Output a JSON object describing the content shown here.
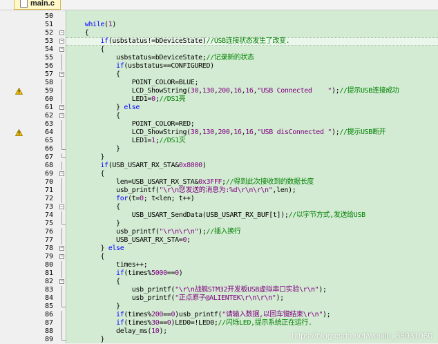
{
  "tab": {
    "file_name": "main.c",
    "icon": "file-icon"
  },
  "watermark": "https://blog.csdn.net/weixin_38931060",
  "colors": {
    "keyword": "#0000ff",
    "number": "#800080",
    "string": "#800080",
    "comment": "#008000",
    "editor_bg": "#d3ebd3"
  },
  "highlight_line": 53,
  "lines": [
    {
      "n": "50",
      "fold": "",
      "warn": false,
      "tokens": []
    },
    {
      "n": "51",
      "fold": "",
      "warn": false,
      "tokens": [
        [
          "p",
          "    "
        ],
        [
          "k",
          "while"
        ],
        [
          "p",
          "("
        ],
        [
          "n",
          "1"
        ],
        [
          "p",
          ")"
        ]
      ]
    },
    {
      "n": "52",
      "fold": "box",
      "warn": false,
      "tokens": [
        [
          "p",
          "    {"
        ]
      ]
    },
    {
      "n": "53",
      "fold": "box",
      "warn": false,
      "tokens": [
        [
          "p",
          "        "
        ],
        [
          "k",
          "if"
        ],
        [
          "p",
          "(usbstatus!=bDeviceState)"
        ],
        [
          "c",
          "//USB连接状态发生了改变."
        ]
      ]
    },
    {
      "n": "54",
      "fold": "box",
      "warn": false,
      "tokens": [
        [
          "p",
          "        {"
        ]
      ]
    },
    {
      "n": "55",
      "fold": "line",
      "warn": false,
      "tokens": [
        [
          "p",
          "            usbstatus=bDeviceState;"
        ],
        [
          "c",
          "//记录新的状态"
        ]
      ]
    },
    {
      "n": "56",
      "fold": "line",
      "warn": false,
      "tokens": [
        [
          "p",
          "            "
        ],
        [
          "k",
          "if"
        ],
        [
          "p",
          "(usbstatus==CONFIGURED)"
        ]
      ]
    },
    {
      "n": "57",
      "fold": "box",
      "warn": false,
      "tokens": [
        [
          "p",
          "            {"
        ]
      ]
    },
    {
      "n": "58",
      "fold": "line",
      "warn": false,
      "tokens": [
        [
          "p",
          "                POINT_COLOR=BLUE;"
        ]
      ]
    },
    {
      "n": "59",
      "fold": "line",
      "warn": true,
      "tokens": [
        [
          "p",
          "                LCD_ShowString("
        ],
        [
          "n",
          "30"
        ],
        [
          "p",
          ","
        ],
        [
          "n",
          "130"
        ],
        [
          "p",
          ","
        ],
        [
          "n",
          "200"
        ],
        [
          "p",
          ","
        ],
        [
          "n",
          "16"
        ],
        [
          "p",
          ","
        ],
        [
          "n",
          "16"
        ],
        [
          "p",
          ","
        ],
        [
          "s",
          "\"USB Connected    \""
        ],
        [
          "p",
          ");"
        ],
        [
          "c",
          "//提示USB连接成功"
        ]
      ]
    },
    {
      "n": "60",
      "fold": "line",
      "warn": false,
      "tokens": [
        [
          "p",
          "                LED1="
        ],
        [
          "n",
          "0"
        ],
        [
          "p",
          ";"
        ],
        [
          "c",
          "//DS1亮"
        ]
      ]
    },
    {
      "n": "61",
      "fold": "box",
      "warn": false,
      "tokens": [
        [
          "p",
          "            } "
        ],
        [
          "k",
          "else"
        ]
      ]
    },
    {
      "n": "62",
      "fold": "box",
      "warn": false,
      "tokens": [
        [
          "p",
          "            {"
        ]
      ]
    },
    {
      "n": "63",
      "fold": "line",
      "warn": false,
      "tokens": [
        [
          "p",
          "                POINT_COLOR=RED;"
        ]
      ]
    },
    {
      "n": "64",
      "fold": "line",
      "warn": true,
      "tokens": [
        [
          "p",
          "                LCD_ShowString("
        ],
        [
          "n",
          "30"
        ],
        [
          "p",
          ","
        ],
        [
          "n",
          "130"
        ],
        [
          "p",
          ","
        ],
        [
          "n",
          "200"
        ],
        [
          "p",
          ","
        ],
        [
          "n",
          "16"
        ],
        [
          "p",
          ","
        ],
        [
          "n",
          "16"
        ],
        [
          "p",
          ","
        ],
        [
          "s",
          "\"USB disConnected \""
        ],
        [
          "p",
          ");"
        ],
        [
          "c",
          "//提示USB断开"
        ]
      ]
    },
    {
      "n": "65",
      "fold": "line",
      "warn": false,
      "tokens": [
        [
          "p",
          "                LED1="
        ],
        [
          "n",
          "1"
        ],
        [
          "p",
          ";"
        ],
        [
          "c",
          "//DS1灭"
        ]
      ]
    },
    {
      "n": "66",
      "fold": "end",
      "warn": false,
      "tokens": [
        [
          "p",
          "            }"
        ]
      ]
    },
    {
      "n": "67",
      "fold": "end",
      "warn": false,
      "tokens": [
        [
          "p",
          "        }"
        ]
      ]
    },
    {
      "n": "68",
      "fold": "line",
      "warn": false,
      "tokens": [
        [
          "p",
          "        "
        ],
        [
          "k",
          "if"
        ],
        [
          "p",
          "(USB_USART_RX_STA&"
        ],
        [
          "n",
          "0x8000"
        ],
        [
          "p",
          ")"
        ]
      ]
    },
    {
      "n": "69",
      "fold": "box",
      "warn": false,
      "tokens": [
        [
          "p",
          "        {"
        ]
      ]
    },
    {
      "n": "70",
      "fold": "line",
      "warn": false,
      "tokens": [
        [
          "p",
          "            len=USB_USART_RX_STA&"
        ],
        [
          "n",
          "0x3FFF"
        ],
        [
          "p",
          ";"
        ],
        [
          "c",
          "//得到此次接收到的数据长度"
        ]
      ]
    },
    {
      "n": "71",
      "fold": "line",
      "warn": false,
      "tokens": [
        [
          "p",
          "            usb_printf("
        ],
        [
          "s",
          "\"\\r\\n您发送的消息为:%d\\r\\n\\r\\n\""
        ],
        [
          "p",
          ",len);"
        ]
      ]
    },
    {
      "n": "72",
      "fold": "line",
      "warn": false,
      "tokens": [
        [
          "p",
          "            "
        ],
        [
          "k",
          "for"
        ],
        [
          "p",
          "(t="
        ],
        [
          "n",
          "0"
        ],
        [
          "p",
          "; t<len; t++)"
        ]
      ]
    },
    {
      "n": "73",
      "fold": "box",
      "warn": false,
      "tokens": [
        [
          "p",
          "            {"
        ]
      ]
    },
    {
      "n": "74",
      "fold": "line",
      "warn": false,
      "tokens": [
        [
          "p",
          "                USB_USART_SendData(USB_USART_RX_BUF[t]);"
        ],
        [
          "c",
          "//以字节方式,发送给USB"
        ]
      ]
    },
    {
      "n": "75",
      "fold": "end",
      "warn": false,
      "tokens": [
        [
          "p",
          "            }"
        ]
      ]
    },
    {
      "n": "76",
      "fold": "line",
      "warn": false,
      "tokens": [
        [
          "p",
          "            usb_printf("
        ],
        [
          "s",
          "\"\\r\\n\\r\\n\""
        ],
        [
          "p",
          ");"
        ],
        [
          "c",
          "//插入换行"
        ]
      ]
    },
    {
      "n": "77",
      "fold": "line",
      "warn": false,
      "tokens": [
        [
          "p",
          "            USB_USART_RX_STA="
        ],
        [
          "n",
          "0"
        ],
        [
          "p",
          ";"
        ]
      ]
    },
    {
      "n": "78",
      "fold": "box",
      "warn": false,
      "tokens": [
        [
          "p",
          "        } "
        ],
        [
          "k",
          "else"
        ]
      ]
    },
    {
      "n": "79",
      "fold": "box",
      "warn": false,
      "tokens": [
        [
          "p",
          "        {"
        ]
      ]
    },
    {
      "n": "80",
      "fold": "line",
      "warn": false,
      "tokens": [
        [
          "p",
          "            times++;"
        ]
      ]
    },
    {
      "n": "81",
      "fold": "line",
      "warn": false,
      "tokens": [
        [
          "p",
          "            "
        ],
        [
          "k",
          "if"
        ],
        [
          "p",
          "(times%"
        ],
        [
          "n",
          "5000"
        ],
        [
          "p",
          "=="
        ],
        [
          "n",
          "0"
        ],
        [
          "p",
          ")"
        ]
      ]
    },
    {
      "n": "82",
      "fold": "box",
      "warn": false,
      "tokens": [
        [
          "p",
          "            {"
        ]
      ]
    },
    {
      "n": "83",
      "fold": "line",
      "warn": false,
      "tokens": [
        [
          "p",
          "                usb_printf("
        ],
        [
          "s",
          "\"\\r\\n战舰STM32开发板USB虚拟串口实验\\r\\n\""
        ],
        [
          "p",
          ");"
        ]
      ]
    },
    {
      "n": "84",
      "fold": "line",
      "warn": false,
      "tokens": [
        [
          "p",
          "                usb_printf("
        ],
        [
          "s",
          "\"正点原子@ALIENTEK\\r\\n\\r\\n\""
        ],
        [
          "p",
          ");"
        ]
      ]
    },
    {
      "n": "85",
      "fold": "end",
      "warn": false,
      "tokens": [
        [
          "p",
          "            }"
        ]
      ]
    },
    {
      "n": "86",
      "fold": "line",
      "warn": false,
      "tokens": [
        [
          "p",
          "            "
        ],
        [
          "k",
          "if"
        ],
        [
          "p",
          "(times%"
        ],
        [
          "n",
          "200"
        ],
        [
          "p",
          "=="
        ],
        [
          "n",
          "0"
        ],
        [
          "p",
          ")usb_printf("
        ],
        [
          "s",
          "\"请输入数据,以回车键结束\\r\\n\""
        ],
        [
          "p",
          ");"
        ]
      ]
    },
    {
      "n": "87",
      "fold": "line",
      "warn": false,
      "tokens": [
        [
          "p",
          "            "
        ],
        [
          "k",
          "if"
        ],
        [
          "p",
          "(times%"
        ],
        [
          "n",
          "30"
        ],
        [
          "p",
          "=="
        ],
        [
          "n",
          "0"
        ],
        [
          "p",
          ")LED0=!LED0;"
        ],
        [
          "c",
          "//闪烁LED,提示系统正在运行."
        ]
      ]
    },
    {
      "n": "88",
      "fold": "line",
      "warn": false,
      "tokens": [
        [
          "p",
          "            delay_ms("
        ],
        [
          "n",
          "10"
        ],
        [
          "p",
          ");"
        ]
      ]
    },
    {
      "n": "89",
      "fold": "end",
      "warn": false,
      "tokens": [
        [
          "p",
          "        }"
        ]
      ]
    }
  ]
}
